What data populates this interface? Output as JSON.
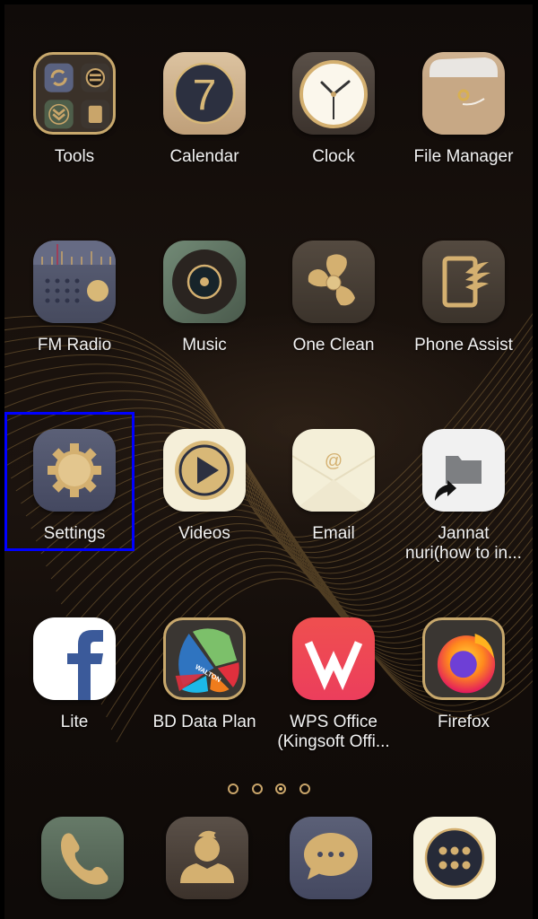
{
  "home_screen": {
    "apps": [
      {
        "name": "Tools",
        "icon": "tools-folder-icon"
      },
      {
        "name": "Calendar",
        "icon": "calendar-icon",
        "day": "7"
      },
      {
        "name": "Clock",
        "icon": "clock-icon"
      },
      {
        "name": "File Manager",
        "icon": "file-manager-icon"
      },
      {
        "name": "FM Radio",
        "icon": "fm-radio-icon"
      },
      {
        "name": "Music",
        "icon": "music-icon"
      },
      {
        "name": "One Clean",
        "icon": "fan-icon"
      },
      {
        "name": "Phone Assist",
        "icon": "phone-assist-icon"
      },
      {
        "name": "Settings",
        "icon": "gear-icon"
      },
      {
        "name": "Videos",
        "icon": "play-icon"
      },
      {
        "name": "Email",
        "icon": "envelope-icon",
        "glyph": "@"
      },
      {
        "name": "Jannat nuri(how to in...",
        "line1": "Jannat",
        "line2": "nuri(how to in...",
        "icon": "folder-shortcut-icon"
      },
      {
        "name": "Lite",
        "icon": "facebook-icon",
        "glyph": "f"
      },
      {
        "name": "BD Data Plan",
        "icon": "walton-icon",
        "brand": "WALTON"
      },
      {
        "name": "WPS Office (Kingsoft Offi...",
        "line1": "WPS Office",
        "line2": "(Kingsoft Offi...",
        "icon": "wps-icon"
      },
      {
        "name": "Firefox",
        "icon": "firefox-icon"
      }
    ],
    "page_indicator": {
      "total": 4,
      "current": 3
    },
    "dock": [
      {
        "name": "Phone",
        "icon": "phone-icon"
      },
      {
        "name": "Contacts",
        "icon": "contact-icon"
      },
      {
        "name": "Messages",
        "icon": "message-icon"
      },
      {
        "name": "App Drawer",
        "icon": "app-drawer-icon"
      }
    ],
    "highlighted_app": "Settings",
    "colors": {
      "gold": "#c9a56a",
      "highlight": "#0000ff",
      "label": "#f2f2f2"
    }
  }
}
